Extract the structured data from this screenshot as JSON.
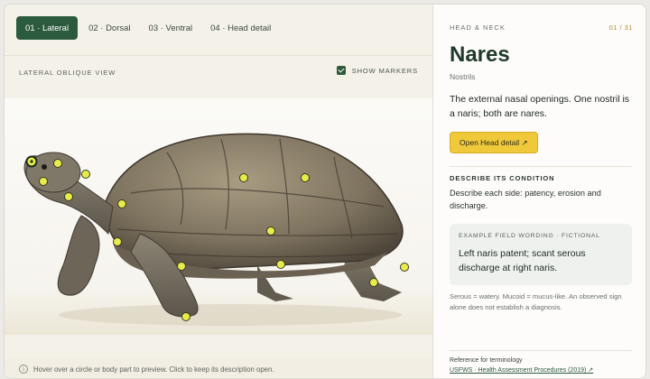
{
  "tabs": [
    {
      "label": "01 · Lateral",
      "active": true
    },
    {
      "label": "02 · Dorsal",
      "active": false
    },
    {
      "label": "03 · Ventral",
      "active": false
    },
    {
      "label": "04 · Head detail",
      "active": false
    }
  ],
  "viewer": {
    "view_label": "LATERAL OBLIQUE VIEW",
    "show_markers_label": "SHOW MARKERS",
    "show_markers_checked": true,
    "hint": "Hover over a circle or body part to preview. Click to keep its description open.",
    "marker_count": 17
  },
  "panel": {
    "kicker": "HEAD & NECK",
    "counter": "01 / 31",
    "title": "Nares",
    "subtitle": "Nostrils",
    "description": "The external nasal openings. One nostril is a naris; both are nares.",
    "open_button": "Open Head detail ↗",
    "section_heading": "DESCRIBE ITS CONDITION",
    "section_body": "Describe each side: patency, erosion and discharge.",
    "example_heading": "EXAMPLE FIELD WORDING · FICTIONAL",
    "example_text": "Left naris patent; scant serous discharge at right naris.",
    "note": "Serous = watery. Mucoid = mucus-like. An observed sign alone does not establish a diagnosis.",
    "reference_heading": "Reference for terminology",
    "reference_link": "USFWS · Health Assessment Procedures (2019) ↗"
  },
  "colors": {
    "accent": "#2c5a3e",
    "button": "#f0c93a",
    "marker": "#e7ec4a"
  }
}
